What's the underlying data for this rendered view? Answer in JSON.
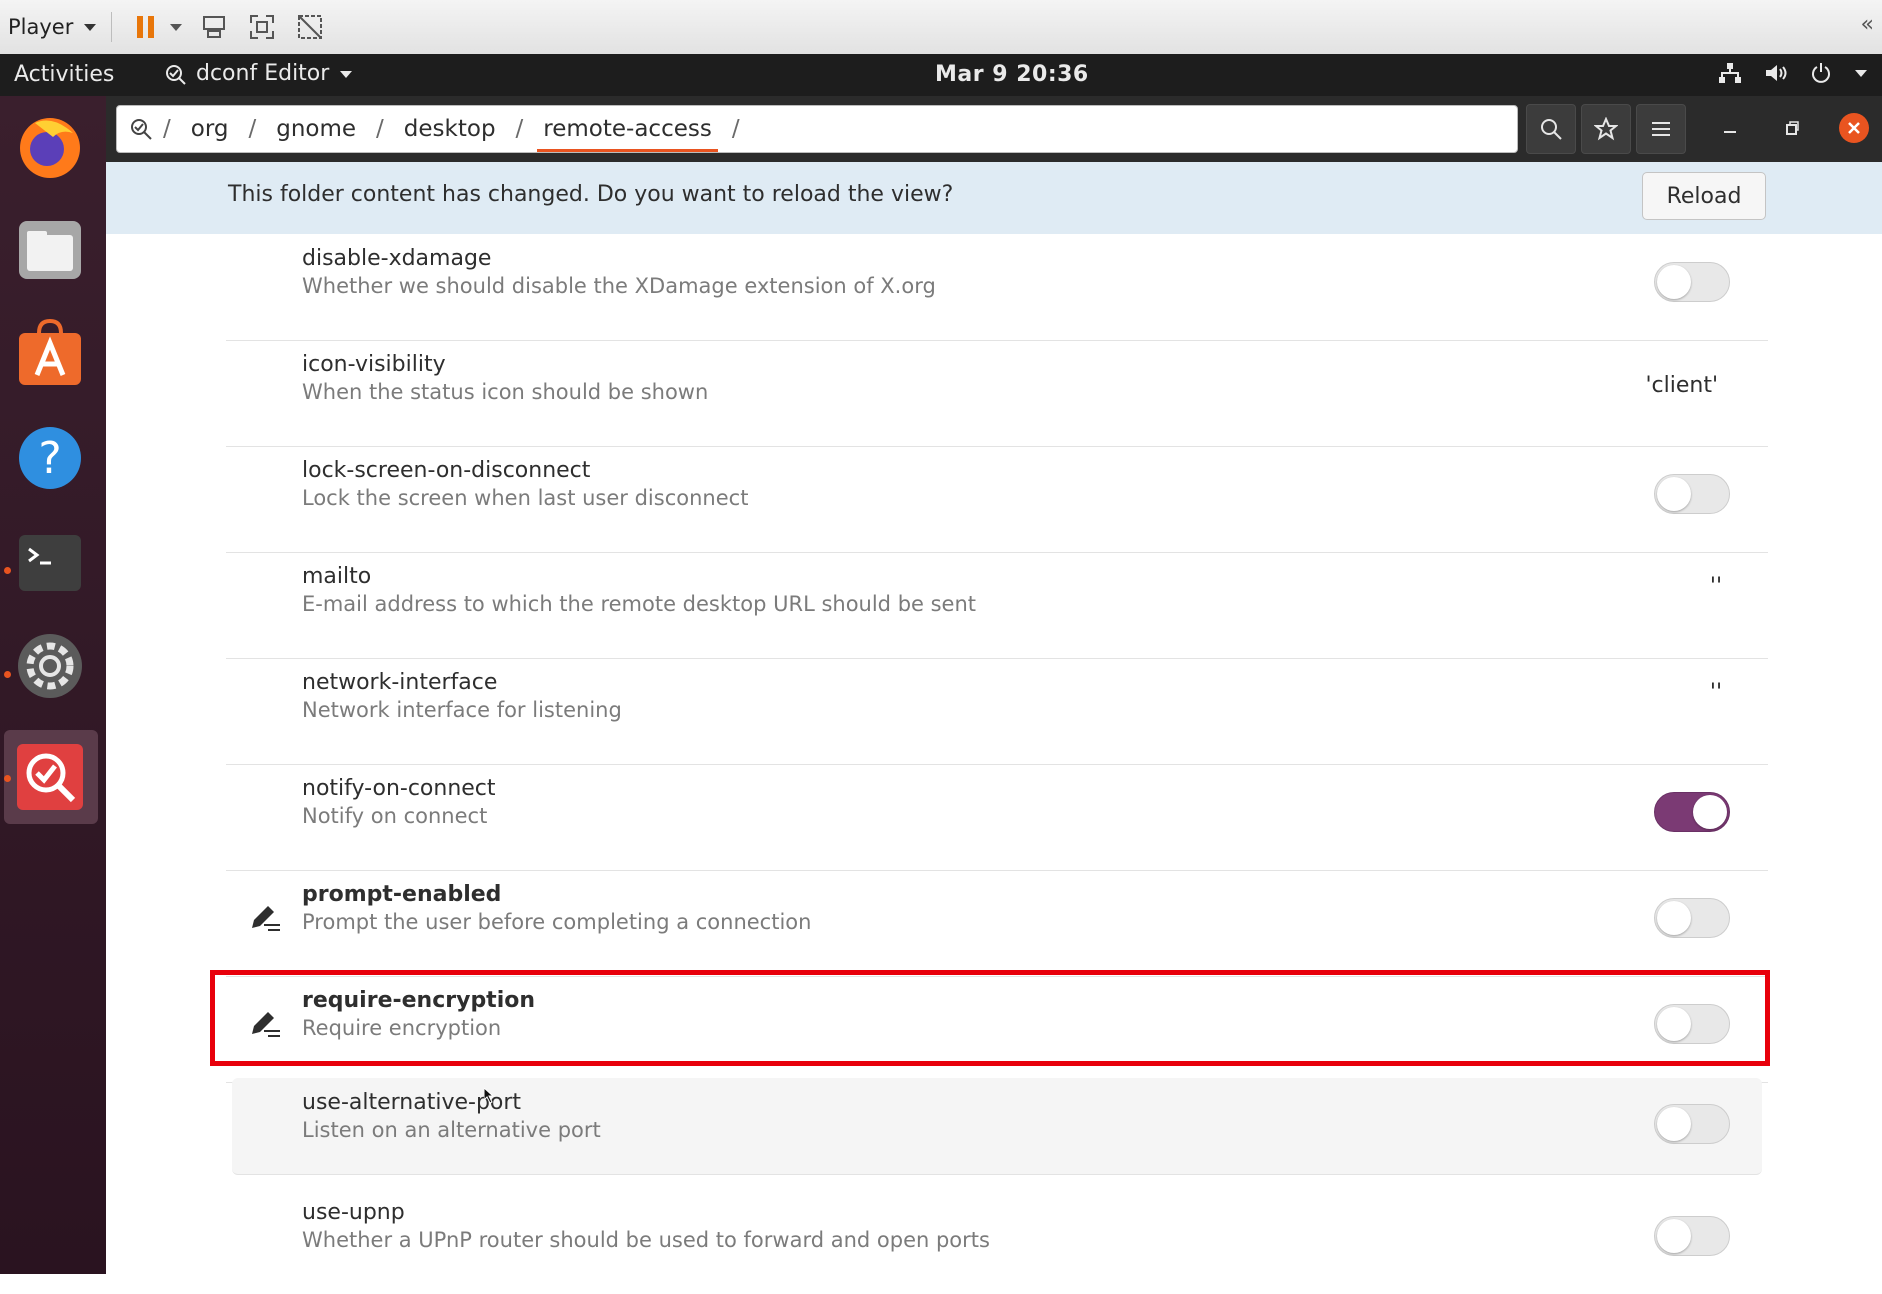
{
  "vm_toolbar": {
    "player_label": "Player"
  },
  "topbar": {
    "activities": "Activities",
    "app_name": "dconf Editor",
    "clock": "Mar 9  20:36"
  },
  "pathbar": {
    "segments": [
      "org",
      "gnome",
      "desktop",
      "remote-access"
    ],
    "separator": "/"
  },
  "infobar": {
    "message": "This folder content has changed. Do you want to reload the view?",
    "reload_label": "Reload"
  },
  "keys": [
    {
      "name": "disable-xdamage",
      "description": "Whether we should disable the XDamage extension of X.org",
      "type": "switch",
      "state": "off"
    },
    {
      "name": "icon-visibility",
      "description": "When the status icon should be shown",
      "type": "value",
      "value": "'client'"
    },
    {
      "name": "lock-screen-on-disconnect",
      "description": "Lock the screen when last user disconnect",
      "type": "switch",
      "state": "off"
    },
    {
      "name": "mailto",
      "description": "E-mail address to which the remote desktop URL should be sent",
      "type": "value",
      "value": "''"
    },
    {
      "name": "network-interface",
      "description": "Network interface for listening",
      "type": "value",
      "value": "''"
    },
    {
      "name": "notify-on-connect",
      "description": "Notify on connect",
      "type": "switch",
      "state": "on"
    },
    {
      "name": "prompt-enabled",
      "description": "Prompt the user before completing a connection",
      "type": "switch",
      "state": "off",
      "modified": true
    },
    {
      "name": "require-encryption",
      "description": "Require encryption",
      "type": "switch",
      "state": "off",
      "modified": true
    },
    {
      "name": "use-alternative-port",
      "description": "Listen on an alternative port",
      "type": "switch",
      "state": "off"
    },
    {
      "name": "use-upnp",
      "description": "Whether a UPnP router should be used to forward and open ports",
      "type": "switch",
      "state": "off"
    }
  ],
  "colors": {
    "accent": "#e95420",
    "switch_on": "#7b3a74",
    "highlight": "#e8000b",
    "infobar_bg": "#dfebf4"
  }
}
